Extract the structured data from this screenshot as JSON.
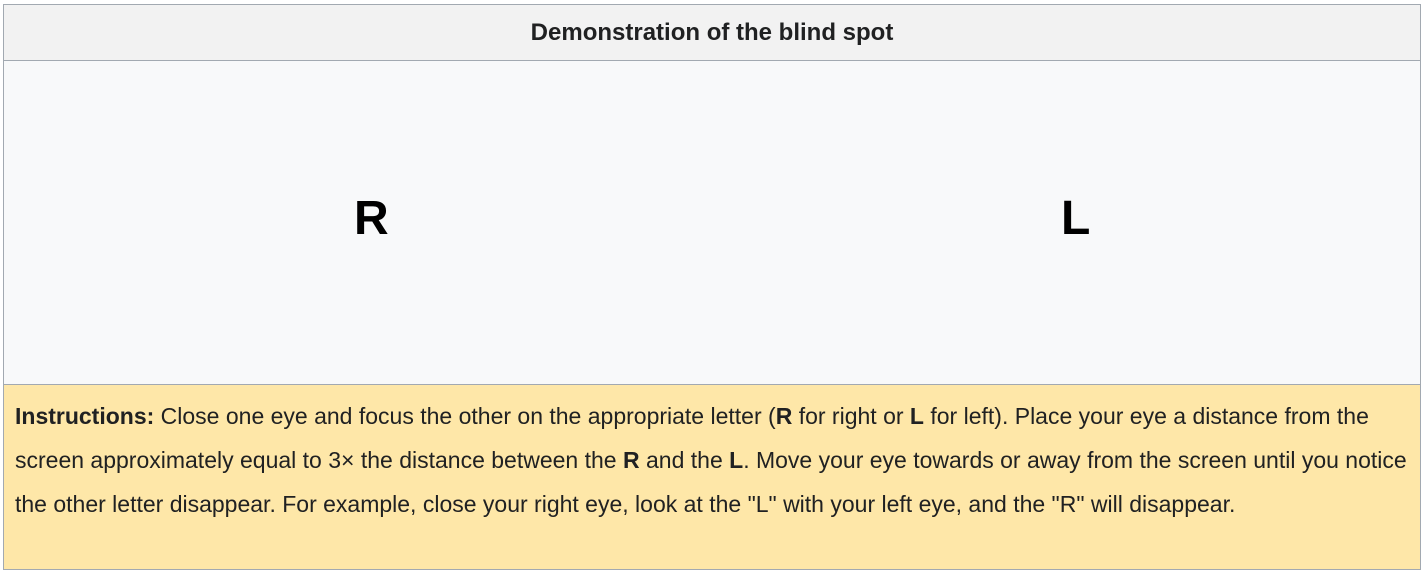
{
  "title": "Demonstration of the blind spot",
  "letters": {
    "right_eye_letter": "R",
    "left_eye_letter": "L"
  },
  "instructions": {
    "label": "Instructions:",
    "t1": " Close one eye and focus the other on the appropriate letter (",
    "b1": "R",
    "t2": " for right or ",
    "b2": "L",
    "t3": " for left). Place your eye a distance from the screen approximately equal to 3× the distance between the ",
    "b3": "R",
    "t4": " and the ",
    "b4": "L",
    "t5": ". Move your eye towards or away from the screen until you notice the other letter disappear. For example, close your right eye, look at the \"L\" with your left eye, and the \"R\" will disappear."
  },
  "colors": {
    "title_background": "#f2f2f2",
    "content_background": "#f8f9fa",
    "instructions_background": "#fee7a8",
    "border": "#a2a9b1"
  }
}
